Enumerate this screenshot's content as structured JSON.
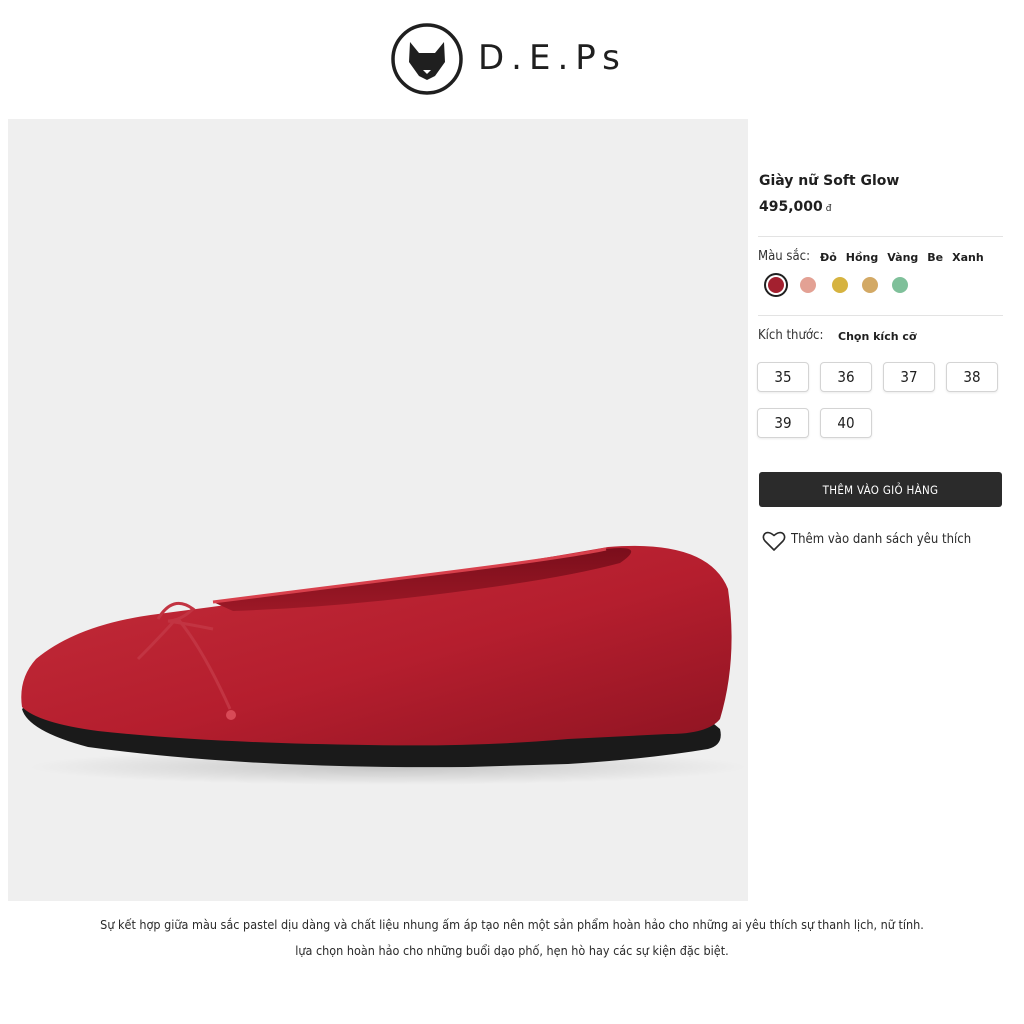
{
  "brand": {
    "name": "D.E.Ps",
    "logo_icon": "fox-head-icon"
  },
  "product": {
    "name": "Giày nữ Soft Glow",
    "price": "495,000",
    "currency": "đ",
    "image_alt": "red-velvet-ballet-flat"
  },
  "color_option": {
    "label": "Màu sắc:",
    "names": [
      "Đỏ",
      "Hồng",
      "Vàng",
      "Be",
      "Xanh"
    ],
    "swatches": [
      "#a3202f",
      "#e3a194",
      "#d6b340",
      "#d3a965",
      "#7fc09a"
    ],
    "selected_index": 0
  },
  "size_option": {
    "label": "Kích thước:",
    "hint": "Chọn kích cỡ",
    "sizes": [
      "35",
      "36",
      "37",
      "38",
      "39",
      "40"
    ]
  },
  "actions": {
    "add_to_cart": "THÊM VÀO GIỎ HÀNG",
    "wishlist": "Thêm vào danh sách yêu thích",
    "wishlist_icon": "heart-outline-icon"
  },
  "description": {
    "lines": [
      "Sự kết hợp giữa màu sắc pastel dịu dàng và chất liệu nhung ấm áp tạo nên một sản phẩm hoàn hảo cho những ai yêu thích sự thanh lịch, nữ tính.",
      "lựa chọn hoàn hảo cho những buổi dạo phố, hẹn hò hay các sự kiện đặc biệt."
    ]
  },
  "colors": {
    "accent_dark": "#2b2b2b",
    "image_bg": "#efefef"
  }
}
